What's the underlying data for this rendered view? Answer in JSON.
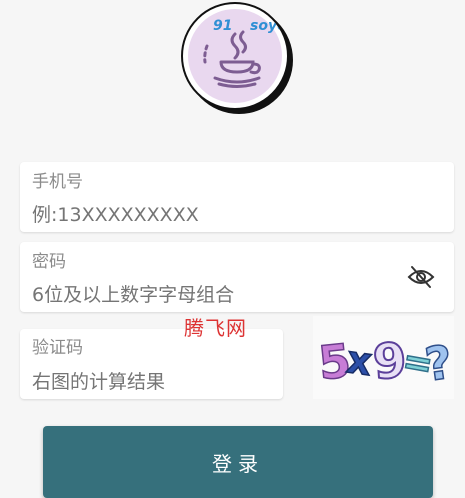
{
  "logo": {
    "text_left": "91",
    "text_right": "soyo"
  },
  "phone": {
    "label": "手机号",
    "placeholder": "例:13XXXXXXXXX"
  },
  "password": {
    "label": "密码",
    "placeholder": "6位及以上数字字母组合",
    "toggle_icon": "eye-slash-icon"
  },
  "captcha": {
    "label": "验证码",
    "placeholder": "右图的计算结果",
    "image_text": "5x9=?"
  },
  "watermark": "腾飞网",
  "login_button": {
    "label": "登录"
  },
  "colors": {
    "button": "#36707c",
    "watermark": "#dd3333",
    "logo_text": "#2f8fd4"
  }
}
